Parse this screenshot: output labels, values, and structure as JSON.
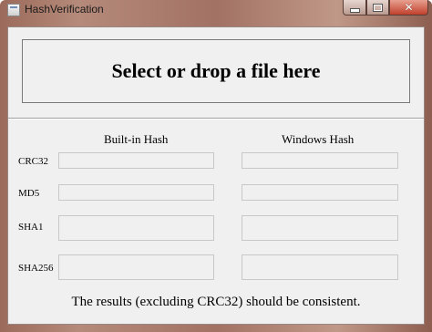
{
  "window": {
    "title": "HashVerification",
    "icon": "app-window-icon",
    "controls": {
      "minimize_icon": "minimize-icon",
      "maximize_icon": "maximize-icon",
      "close_icon": "close-icon",
      "close_glyph": "✕"
    }
  },
  "drop_zone": {
    "label": "Select or drop a file here"
  },
  "columns": {
    "builtin": "Built-in Hash",
    "windows": "Windows Hash"
  },
  "rows": [
    {
      "label": "CRC32",
      "builtin_value": "",
      "windows_value": ""
    },
    {
      "label": "MD5",
      "builtin_value": "",
      "windows_value": ""
    },
    {
      "label": "SHA1",
      "builtin_value": "",
      "windows_value": ""
    },
    {
      "label": "SHA256",
      "builtin_value": "",
      "windows_value": ""
    }
  ],
  "footer": {
    "note": "The results (excluding CRC32) should be consistent."
  },
  "colors": {
    "titlebar": "#a27264",
    "client_bg": "#f0f0f0",
    "close_button": "#c0402c"
  }
}
